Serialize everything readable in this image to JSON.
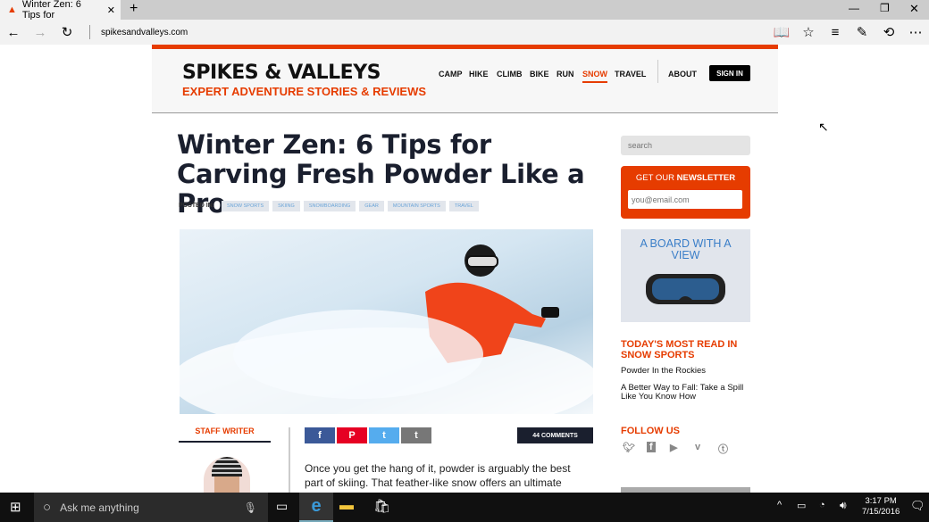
{
  "browser": {
    "tab_title": "Winter Zen: 6 Tips for",
    "url": "spikesandvalleys.com"
  },
  "site": {
    "logo": "SPIKES & VALLEYS",
    "tagline": "EXPERT ADVENTURE STORIES & REVIEWS",
    "nav": [
      "CAMP",
      "HIKE",
      "CLIMB",
      "BIKE",
      "RUN",
      "SNOW",
      "TRAVEL"
    ],
    "active_nav": "SNOW",
    "about": "ABOUT",
    "sign_in": "SIGN IN",
    "accent": "#e63c00"
  },
  "article": {
    "title": "Winter Zen: 6 Tips for Carving Fresh Powder Like a Pro",
    "posted_in": "POSTED IN:",
    "tags": [
      "SNOW SPORTS",
      "SKIING",
      "SNOWBOARDING",
      "GEAR",
      "MOUNTAIN SPORTS",
      "TRAVEL"
    ],
    "author_label": "STAFF WRITER",
    "comments": "44 COMMENTS",
    "share": [
      {
        "icon": "f",
        "color": "#3b5998"
      },
      {
        "icon": "P",
        "color": "#e60023"
      },
      {
        "icon": "t",
        "color": "#55acee"
      },
      {
        "icon": "t",
        "color": "#777777"
      }
    ],
    "body": "Once you get the hang of it, powder is arguably the best part of skiing. That feather-like snow offers an ultimate"
  },
  "sidebar": {
    "search_placeholder": "search",
    "newsletter_pre": "GET OUR ",
    "newsletter_bold": "NEWSLETTER",
    "email_placeholder": "you@email.com",
    "ad_text": "A BOARD WITH A VIEW",
    "most_read": "TODAY'S MOST READ IN SNOW SPORTS",
    "links": [
      "Powder In the Rockies",
      "A Better Way to Fall: Take a Spill Like You Know How"
    ],
    "follow": "FOLLOW US",
    "social": [
      "twitter-icon",
      "facebook-icon",
      "youtube-icon",
      "vimeo-icon",
      "tumblr-icon"
    ]
  },
  "taskbar": {
    "search": "Ask me anything",
    "time": "3:17 PM",
    "date": "7/15/2016"
  }
}
